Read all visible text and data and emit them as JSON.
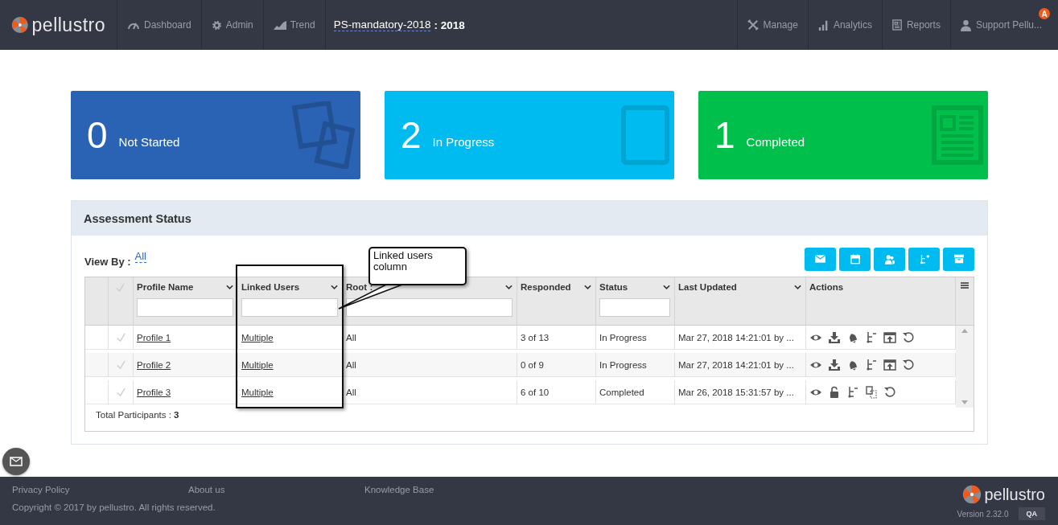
{
  "nav": {
    "brand": "pellustro",
    "left": [
      "Dashboard",
      "Admin",
      "Trend"
    ],
    "project": "PS-mandatory-2018",
    "separator": ":",
    "year": "2018",
    "right": [
      "Manage",
      "Analytics",
      "Reports"
    ],
    "user": "Support Pellu...",
    "badge": "A"
  },
  "cards": [
    {
      "count": "0",
      "label": "Not Started",
      "color": "#2a63b4"
    },
    {
      "count": "2",
      "label": "In Progress",
      "color": "#00bbf0"
    },
    {
      "count": "1",
      "label": "Completed",
      "color": "#00c04b"
    }
  ],
  "panel": {
    "title": "Assessment Status",
    "view_by_label": "View By :",
    "view_by_value": "All",
    "columns": [
      {
        "label": "Profile Name",
        "sortable": true,
        "filter": true
      },
      {
        "label": "Linked Users",
        "sortable": true,
        "filter": true
      },
      {
        "label": "Root :",
        "sortable": true,
        "filter": true
      },
      {
        "label": "Responded",
        "sortable": true,
        "filter": false
      },
      {
        "label": "Status",
        "sortable": true,
        "filter": true
      },
      {
        "label": "Last Updated",
        "sortable": true,
        "filter": false
      },
      {
        "label": "Actions",
        "sortable": false,
        "filter": false
      }
    ],
    "rows": [
      {
        "profile": "Profile 1",
        "linked": "Multiple",
        "root": "All",
        "responded": "3 of 13",
        "status": "In Progress",
        "updated": "Mar 27, 2018 14:21:01 by ...",
        "actions": [
          {
            "kind": "view"
          },
          {
            "kind": "download"
          },
          {
            "kind": "remind"
          },
          {
            "kind": "tree"
          },
          {
            "kind": "publish"
          },
          {
            "kind": "reset"
          }
        ]
      },
      {
        "profile": "Profile 2",
        "linked": "Multiple",
        "root": "All",
        "responded": "0 of 9",
        "status": "In Progress",
        "updated": "Mar 27, 2018 14:21:01 by ...",
        "actions": [
          {
            "kind": "view"
          },
          {
            "kind": "download"
          },
          {
            "kind": "remind"
          },
          {
            "kind": "tree"
          },
          {
            "kind": "publish"
          },
          {
            "kind": "reset"
          }
        ]
      },
      {
        "profile": "Profile 3",
        "linked": "Multiple",
        "root": "All",
        "responded": "6 of 10",
        "status": "Completed",
        "updated": "Mar 26, 2018 15:31:57 by ...",
        "actions": [
          {
            "kind": "view"
          },
          {
            "kind": "lock"
          },
          {
            "kind": "tree"
          },
          {
            "kind": "copy"
          },
          {
            "kind": "reset"
          }
        ]
      }
    ],
    "total_label": "Total Participants :",
    "total_value": "3"
  },
  "annotation": {
    "text": "Linked users column"
  },
  "footer": {
    "links": [
      "Privacy Policy",
      "About us",
      "Knowledge Base"
    ],
    "copyright": "Copyright © 2017 by pellustro. All rights reserved.",
    "brand": "pellustro",
    "version": "Version 2.32.0",
    "environment": "QA"
  }
}
